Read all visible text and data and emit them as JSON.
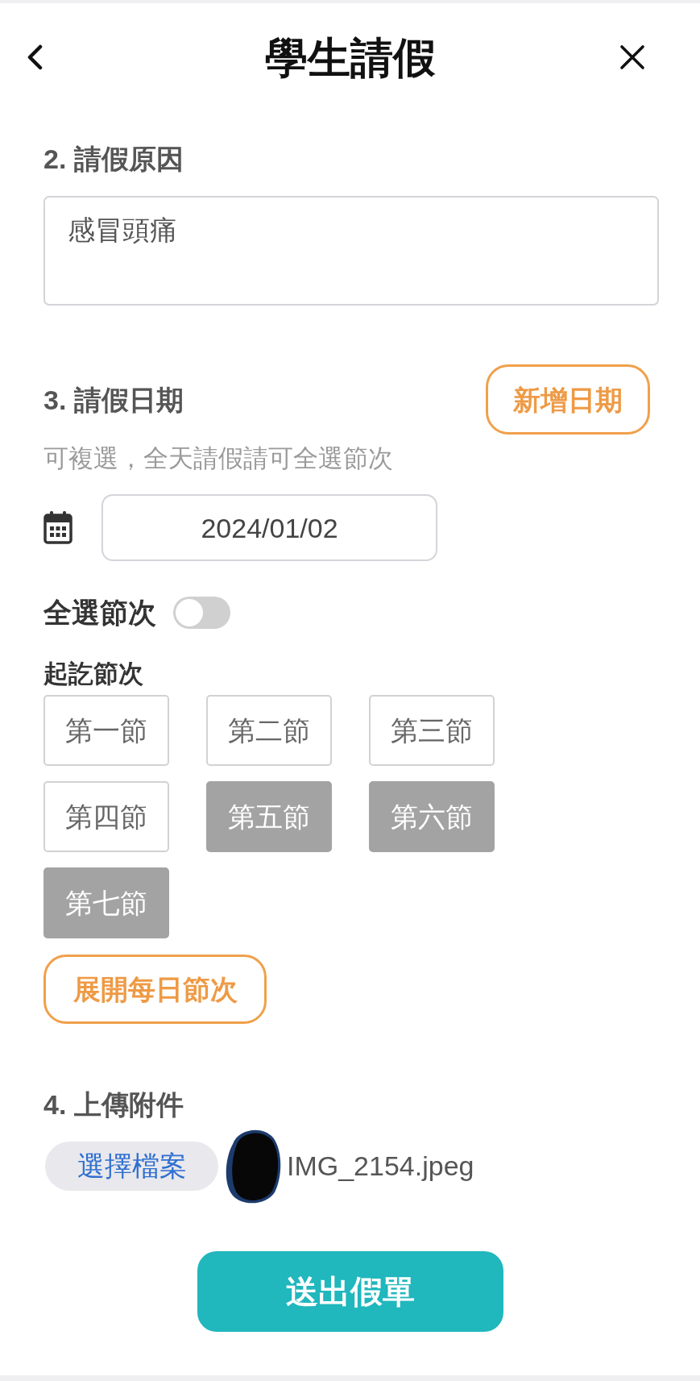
{
  "header": {
    "title": "學生請假"
  },
  "reason": {
    "label": "2. 請假原因",
    "value": "感冒頭痛"
  },
  "dates": {
    "label": "3. 請假日期",
    "add_button": "新增日期",
    "hint": "可複選，全天請假請可全選節次",
    "date": "2024/01/02",
    "select_all": {
      "label": "全選節次",
      "on": false
    },
    "periods_label": "起訖節次",
    "periods": [
      {
        "label": "第一節",
        "selected": false
      },
      {
        "label": "第二節",
        "selected": false
      },
      {
        "label": "第三節",
        "selected": false
      },
      {
        "label": "第四節",
        "selected": false
      },
      {
        "label": "第五節",
        "selected": true
      },
      {
        "label": "第六節",
        "selected": true
      },
      {
        "label": "第七節",
        "selected": true
      }
    ],
    "expand_button": "展開每日節次"
  },
  "attachment": {
    "label": "4. 上傳附件",
    "choose_button": "選擇檔案",
    "file_name": "IMG_2154.jpeg"
  },
  "submit_button": "送出假單"
}
